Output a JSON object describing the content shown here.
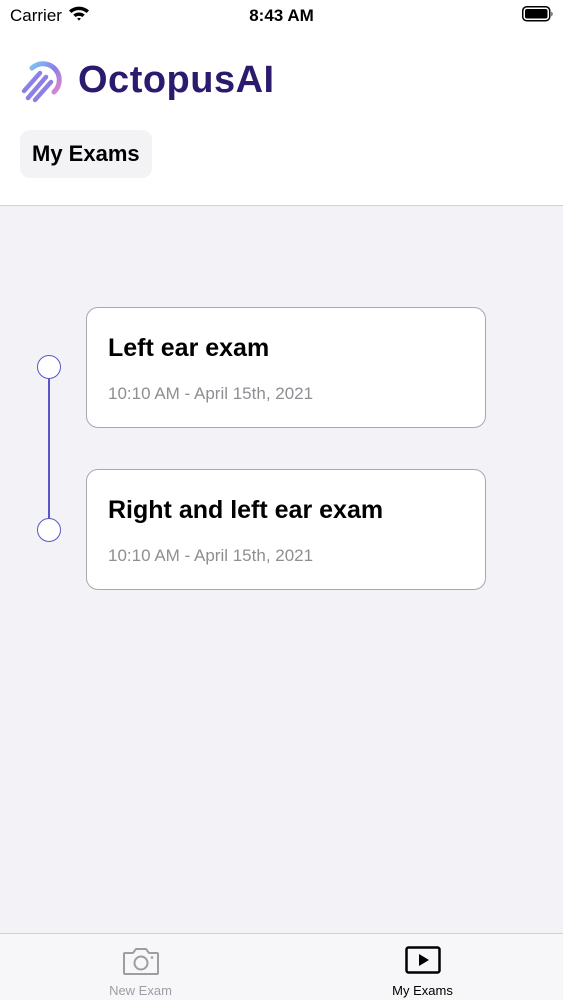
{
  "status_bar": {
    "carrier": "Carrier",
    "time": "8:43 AM",
    "wifi_icon": "wifi-icon",
    "battery_icon": "battery-icon"
  },
  "header": {
    "app_name": "OctopusAI",
    "logo_icon": "octopus-logo-icon",
    "section_label": "My Exams"
  },
  "exams": [
    {
      "title": "Left ear exam",
      "date": "10:10 AM - April 15th, 2021"
    },
    {
      "title": "Right and left ear exam",
      "date": "10:10 AM - April 15th, 2021"
    }
  ],
  "tab_bar": {
    "tabs": [
      {
        "label": "New Exam",
        "icon": "camera-icon",
        "selected": false
      },
      {
        "label": "My Exams",
        "icon": "play-icon",
        "selected": true
      }
    ]
  },
  "colors": {
    "brand_text": "#2b1a6e",
    "timeline_accent": "#5856c9",
    "background": "#f2f2f7",
    "secondary_text": "#8e8e93"
  }
}
